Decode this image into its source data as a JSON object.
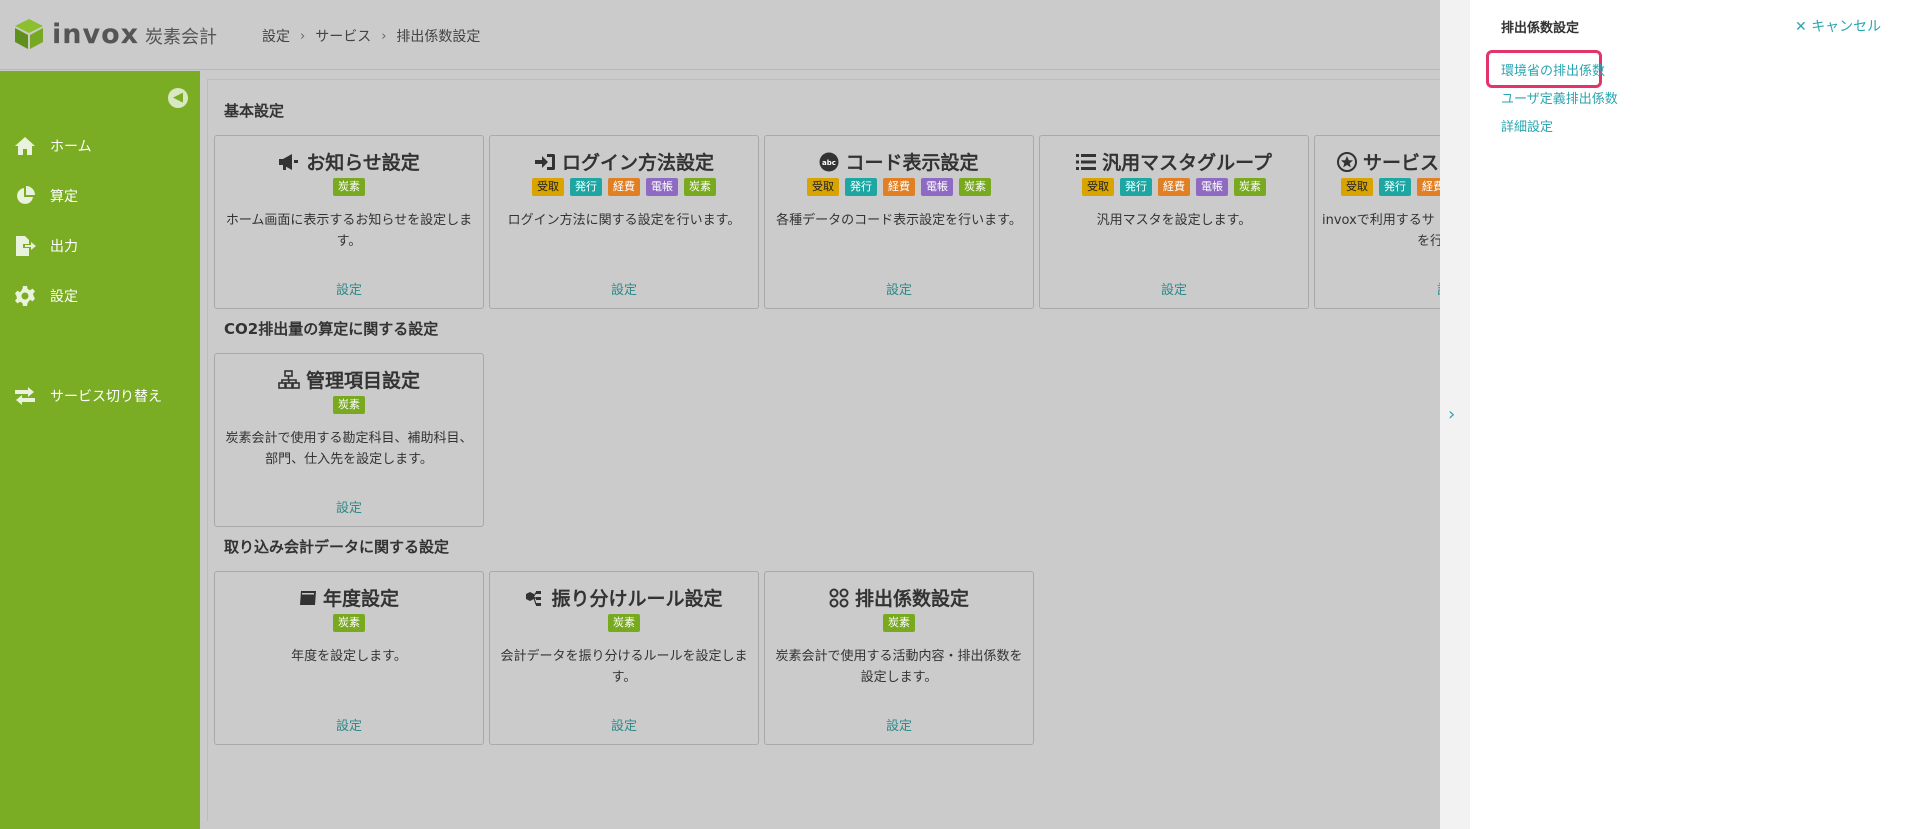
{
  "header": {
    "brand": "invox",
    "brand_sub": "炭素会計",
    "breadcrumb": [
      "設定",
      "サービス",
      "排出係数設定"
    ]
  },
  "sidebar": {
    "items": [
      {
        "label": "ホーム",
        "icon": "home-icon"
      },
      {
        "label": "算定",
        "icon": "pie-chart-icon"
      },
      {
        "label": "出力",
        "icon": "file-export-icon"
      },
      {
        "label": "設定",
        "icon": "gear-icon"
      },
      {
        "label": "サービス切り替え",
        "icon": "switch-icon"
      }
    ]
  },
  "sections": [
    {
      "title": "基本設定"
    },
    {
      "title": "CO2排出量の算定に関する設定"
    },
    {
      "title": "取り込み会計データに関する設定"
    }
  ],
  "tags": {
    "uke": "受取",
    "hak": "発行",
    "kei": "経費",
    "den": "電帳",
    "tan": "炭素"
  },
  "cards": [
    {
      "title": "お知らせ設定",
      "desc": "ホーム画面に表示するお知らせを設定します。",
      "link": "設定"
    },
    {
      "title": "ログイン方法設定",
      "desc": "ログイン方法に関する設定を行います。",
      "link": "設定"
    },
    {
      "title": "コード表示設定",
      "desc": "各種データのコード表示設定を行います。",
      "link": "設定"
    },
    {
      "title": "汎用マスタグループ",
      "desc": "汎用マスタを設定します。",
      "link": "設定"
    },
    {
      "title": "サービス",
      "desc": "invoxで利用するサ",
      "desc2": "を行い",
      "link": "設定"
    },
    {
      "title": "管理項目設定",
      "desc": "炭素会計で使用する勘定科目、補助科目、部門、仕入先を設定します。",
      "link": "設定"
    },
    {
      "title": "年度設定",
      "desc": "年度を設定します。",
      "link": "設定"
    },
    {
      "title": "振り分けルール設定",
      "desc": "会計データを振り分けるルールを設定します。",
      "link": "設定"
    },
    {
      "title": "排出係数設定",
      "desc": "炭素会計で使用する活動内容・排出係数を設定します。",
      "link": "設定"
    }
  ],
  "panel": {
    "title": "排出係数設定",
    "cancel": "キャンセル",
    "links": [
      "環境省の排出係数",
      "ユーザ定義排出係数",
      "詳細設定"
    ]
  },
  "colors": {
    "sidebar": "#7aac24",
    "accent": "#2aa6b0",
    "highlight": "#e3336b"
  }
}
